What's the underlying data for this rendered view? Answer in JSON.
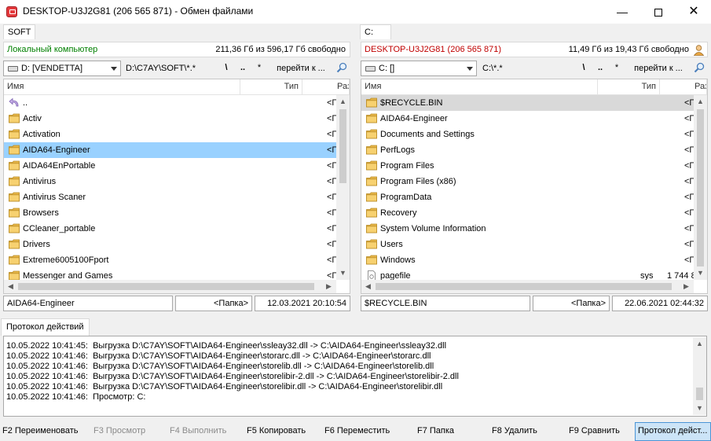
{
  "window": {
    "title": "DESKTOP-U3J2G81 (206 565 871) - Обмен файлами",
    "minimize_icon": "minimize-icon",
    "maximize_icon": "maximize-icon",
    "close_icon": "close-icon"
  },
  "left_panel": {
    "tab": "SOFT",
    "location_label": "Локальный компьютер",
    "location_color": "#008000",
    "free_space": "211,36 Гб из 596,17 Гб свободно",
    "drive": "D: [VENDETTA]",
    "path": "D:\\C7AY\\SOFT\\*.*",
    "nav_root": "\\",
    "nav_up": "..",
    "nav_all": "*",
    "goto": "перейти к ...",
    "columns": [
      "Имя",
      "Тип",
      "Раз"
    ],
    "items": [
      {
        "name": "..",
        "type": "<Г",
        "icon": "up-arrow-icon"
      },
      {
        "name": "Activ",
        "type": "<Г",
        "icon": "folder-icon"
      },
      {
        "name": "Activation",
        "type": "<Г",
        "icon": "folder-icon"
      },
      {
        "name": "AIDA64-Engineer",
        "type": "<Г",
        "icon": "folder-icon",
        "selected": true
      },
      {
        "name": "AIDA64EnPortable",
        "type": "<Г",
        "icon": "folder-icon"
      },
      {
        "name": "Antivirus",
        "type": "<Г",
        "icon": "folder-icon"
      },
      {
        "name": "Antivirus Scaner",
        "type": "<Г",
        "icon": "folder-icon"
      },
      {
        "name": "Browsers",
        "type": "<Г",
        "icon": "folder-icon"
      },
      {
        "name": "CCleaner_portable",
        "type": "<Г",
        "icon": "folder-icon"
      },
      {
        "name": "Drivers",
        "type": "<Г",
        "icon": "folder-icon"
      },
      {
        "name": "Extreme6005100Fport",
        "type": "<Г",
        "icon": "folder-icon"
      },
      {
        "name": "Messenger and Games",
        "type": "<Г",
        "icon": "folder-icon"
      }
    ],
    "status_name": "AIDA64-Engineer",
    "status_type": "<Папка>",
    "status_date": "12.03.2021 20:10:54"
  },
  "right_panel": {
    "tab": "C:",
    "location_label": "DESKTOP-U3J2G81 (206 565 871)",
    "location_color": "#c00000",
    "free_space": "11,49 Гб из 19,43 Гб свободно",
    "user_icon": "user-icon",
    "drive": "C: []",
    "path": "C:\\*.*",
    "nav_root": "\\",
    "nav_up": "..",
    "nav_all": "*",
    "goto": "перейти к ...",
    "columns": [
      "Имя",
      "Тип",
      "Раз"
    ],
    "items": [
      {
        "name": "$RECYCLE.BIN",
        "type": "<Г",
        "icon": "folder-icon",
        "highlighted": true
      },
      {
        "name": "AIDA64-Engineer",
        "type": "<Г",
        "icon": "folder-icon"
      },
      {
        "name": "Documents and Settings",
        "type": "<Г",
        "icon": "folder-icon"
      },
      {
        "name": "PerfLogs",
        "type": "<Г",
        "icon": "folder-icon"
      },
      {
        "name": "Program Files",
        "type": "<Г",
        "icon": "folder-icon"
      },
      {
        "name": "Program Files (x86)",
        "type": "<Г",
        "icon": "folder-icon"
      },
      {
        "name": "ProgramData",
        "type": "<Г",
        "icon": "folder-icon"
      },
      {
        "name": "Recovery",
        "type": "<Г",
        "icon": "folder-icon"
      },
      {
        "name": "System Volume Information",
        "type": "<Г",
        "icon": "folder-icon"
      },
      {
        "name": "Users",
        "type": "<Г",
        "icon": "folder-icon"
      },
      {
        "name": "Windows",
        "type": "<Г",
        "icon": "folder-icon"
      },
      {
        "name": "pagefile",
        "type": "sys",
        "size": "1 744 8",
        "icon": "file-icon"
      }
    ],
    "status_name": "$RECYCLE.BIN",
    "status_type": "<Папка>",
    "status_date": "22.06.2021 02:44:32"
  },
  "log": {
    "tab": "Протокол действий",
    "lines": [
      "10.05.2022 10:41:45:  Выгрузка D:\\C7AY\\SOFT\\AIDA64-Engineer\\ssleay32.dll -> C:\\AIDA64-Engineer\\ssleay32.dll",
      "10.05.2022 10:41:46:  Выгрузка D:\\C7AY\\SOFT\\AIDA64-Engineer\\storarc.dll -> C:\\AIDA64-Engineer\\storarc.dll",
      "10.05.2022 10:41:46:  Выгрузка D:\\C7AY\\SOFT\\AIDA64-Engineer\\storelib.dll -> C:\\AIDA64-Engineer\\storelib.dll",
      "10.05.2022 10:41:46:  Выгрузка D:\\C7AY\\SOFT\\AIDA64-Engineer\\storelibir-2.dll -> C:\\AIDA64-Engineer\\storelibir-2.dll",
      "10.05.2022 10:41:46:  Выгрузка D:\\C7AY\\SOFT\\AIDA64-Engineer\\storelibir.dll -> C:\\AIDA64-Engineer\\storelibir.dll",
      "10.05.2022 10:41:46:  Просмотр: C:"
    ]
  },
  "fkeys": {
    "f2": "F2 Переименовать",
    "f3": "F3 Просмотр",
    "f4": "F4 Выполнить",
    "f5": "F5 Копировать",
    "f6": "F6 Переместить",
    "f7": "F7 Папка",
    "f8": "F8 Удалить",
    "f9": "F9 Сравнить",
    "log": "Протокол дейст..."
  }
}
